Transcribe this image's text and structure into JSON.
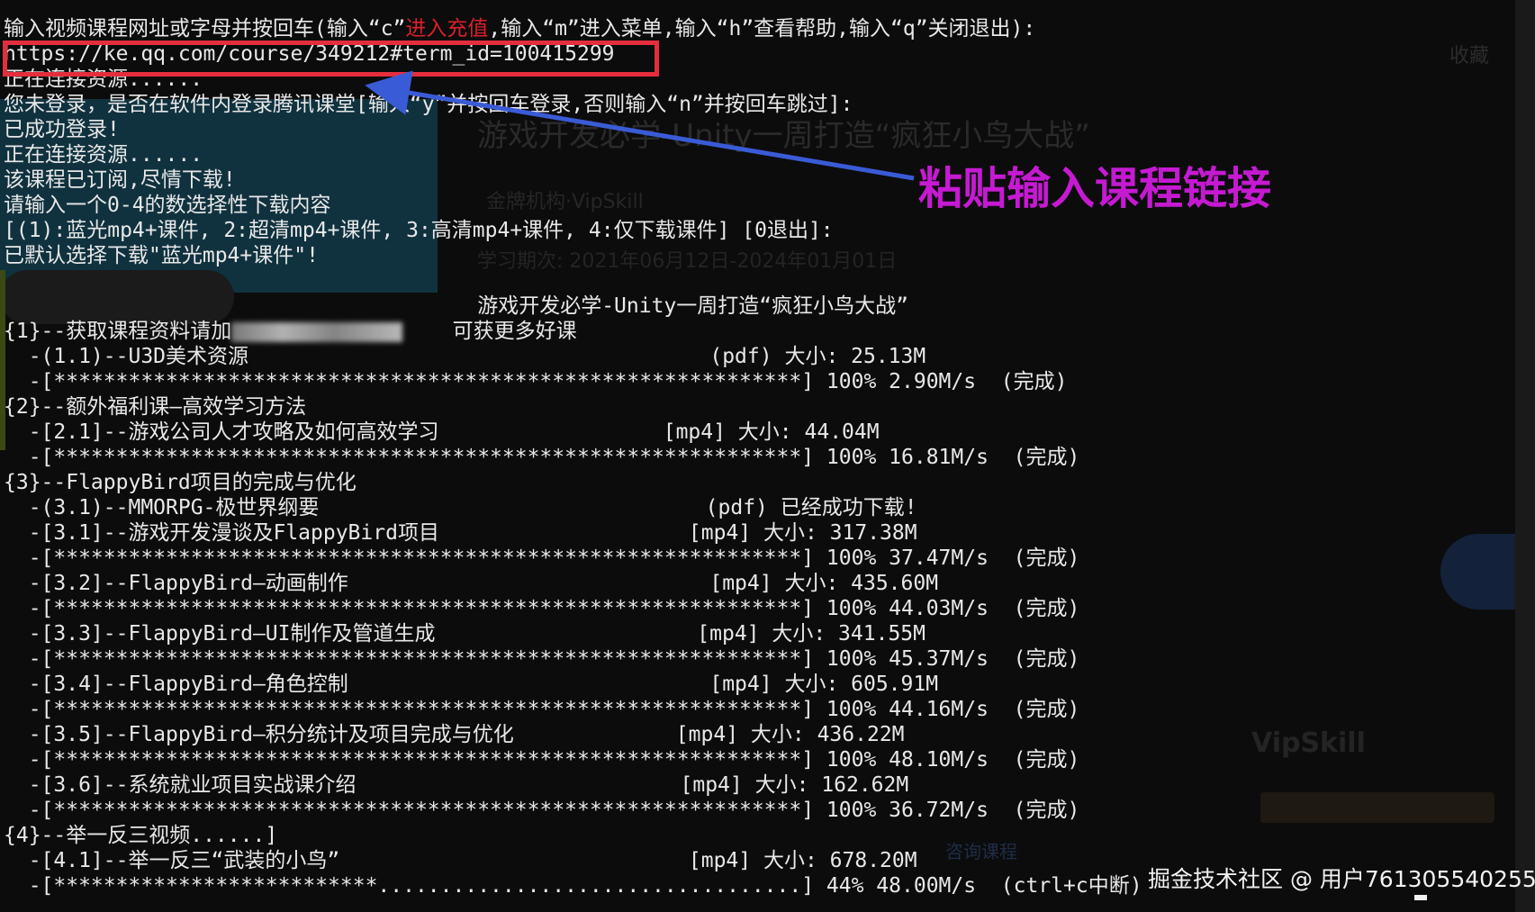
{
  "terminal": {
    "prompt": "输入视频课程网址或字母并按回车(输入“c”",
    "prompt_red": "进入充值",
    "prompt_tail": ",输入“m”进入菜单,输入“h”查看帮助,输入“q”关闭退出):",
    "url_input": "https://ke.qq.com/course/349212#term_id=100415299",
    "connecting_1": "正在连接资源......",
    "login_question": "您未登录，是否在软件内登录腾讯课堂[输入“y”并按回车登录,否则输入“n”并按回车跳过]:",
    "login_success": "已成功登录!",
    "connecting_2": "正在连接资源......",
    "subscribed": "该课程已订阅,尽情下载!",
    "select_prompt": "请输入一个0-4的数选择性下载内容",
    "options": "[(1):蓝光mp4+课件, 2:超清mp4+课件, 3:高清mp4+课件, 4:仅下载课件] [0退出]:",
    "default_choice": "已默认选择下载\"蓝光mp4+课件\"!",
    "course_title": "游戏开发必学-Unity一周打造“疯狂小鸟大战”",
    "course_subtitle": "可获更多好课",
    "sections": [
      {
        "title": "{1}--获取课程资料请加",
        "blurred": true
      },
      {
        "title": "{2}--额外福利课—高效学习方法"
      },
      {
        "title": "{3}--FlappyBird项目的完成与优化"
      },
      {
        "title": "{4}--举一反三视频......]"
      }
    ],
    "items": [
      {
        "name": "-(1.1)--U3D美术资源",
        "type": "(pdf)",
        "status": "大小: 25.13M",
        "percent": "100%",
        "speed": "2.90M/s",
        "result": "(完成)"
      },
      {
        "name": "-[2.1]--游戏公司人才攻略及如何高效学习",
        "type": "[mp4]",
        "status": "大小: 44.04M",
        "percent": "100%",
        "speed": "16.81M/s",
        "result": "(完成)"
      },
      {
        "name": "-(3.1)--MMORPG-极世界纲要",
        "type": "(pdf)",
        "status": "已经成功下载!"
      },
      {
        "name": "-[3.1]--游戏开发漫谈及FlappyBird项目",
        "type": "[mp4]",
        "status": "大小: 317.38M",
        "percent": "100%",
        "speed": "37.47M/s",
        "result": "(完成)"
      },
      {
        "name": "-[3.2]--FlappyBird—动画制作",
        "type": "[mp4]",
        "status": "大小: 435.60M",
        "percent": "100%",
        "speed": "44.03M/s",
        "result": "(完成)"
      },
      {
        "name": "-[3.3]--FlappyBird—UI制作及管道生成",
        "type": "[mp4]",
        "status": "大小: 341.55M",
        "percent": "100%",
        "speed": "45.37M/s",
        "result": "(完成)"
      },
      {
        "name": "-[3.4]--FlappyBird—角色控制",
        "type": "[mp4]",
        "status": "大小: 605.91M",
        "percent": "100%",
        "speed": "44.16M/s",
        "result": "(完成)"
      },
      {
        "name": "-[3.5]--FlappyBird—积分统计及项目完成与优化",
        "type": "[mp4]",
        "status": "大小: 436.22M",
        "percent": "100%",
        "speed": "48.10M/s",
        "result": "(完成)"
      },
      {
        "name": "-[3.6]--系统就业项目实战课介绍",
        "type": "[mp4]",
        "status": "大小: 162.62M",
        "percent": "100%",
        "speed": "36.72M/s",
        "result": "(完成)"
      },
      {
        "name": "-[4.1]--举一反三“武装的小鸟”",
        "type": "[mp4]",
        "status": "大小: 678.20M",
        "percent": "44%",
        "speed": "48.00M/s",
        "result": "(ctrl+c中断)"
      }
    ],
    "progress_bars": [
      {
        "fraction": 1.0
      },
      {
        "fraction": 1.0
      },
      {
        "fraction": 1.0
      },
      {
        "fraction": 1.0
      },
      {
        "fraction": 1.0
      },
      {
        "fraction": 1.0
      },
      {
        "fraction": 1.0
      },
      {
        "fraction": 1.0
      },
      {
        "fraction": 0.44
      }
    ]
  },
  "annotation": {
    "label": "粘贴输入课程链接",
    "color": "#c51ad2",
    "box_color": "#e52e3d",
    "arrow_color": "#3a5bd6"
  },
  "background_page": {
    "title": "游戏开发必学-Unity一周打造“疯狂小鸟大战”",
    "org": "金牌机构·VipSkill",
    "period": "学习期次: 2021年06月12日-2024年01月01日",
    "favorite": "收藏",
    "brand": "VipSkill",
    "consult": "咨询课程"
  },
  "watermark": "掘金技术社区 @ 用户761305540255",
  "colors": {
    "background": "#0c0c0c",
    "text": "#e8e8e8",
    "red_text": "#d9202a"
  }
}
